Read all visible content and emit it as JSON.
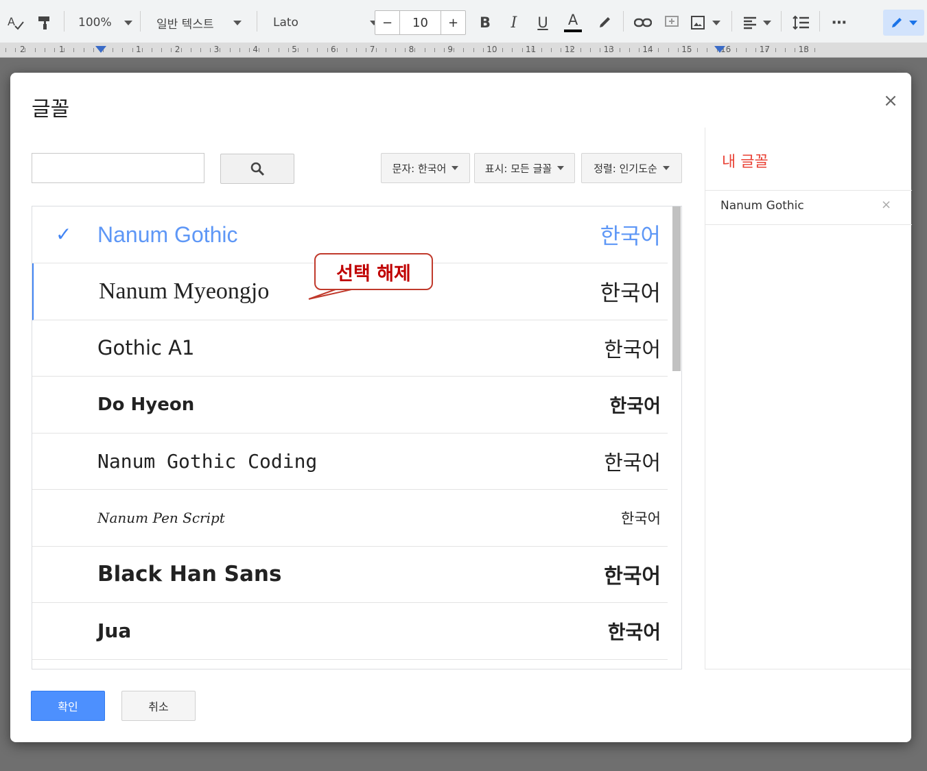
{
  "toolbar": {
    "zoom": "100%",
    "style": "일반 텍스트",
    "font": "Lato",
    "font_size": "10",
    "minus": "−",
    "plus": "+",
    "bold": "B",
    "italic": "I",
    "underline": "U",
    "text_color": "A",
    "more": "⋯"
  },
  "ruler": {
    "numbers": [
      "2",
      "1",
      "1",
      "2",
      "3",
      "4",
      "5",
      "6",
      "7",
      "8",
      "9",
      "10",
      "11",
      "12",
      "13",
      "14",
      "15",
      "16",
      "17",
      "18"
    ]
  },
  "dialog": {
    "title": "글꼴",
    "close": "×",
    "search_value": "",
    "filters": {
      "script": "문자: 한국어",
      "show": "표시: 모든 글꼴",
      "sort": "정렬: 인기도순"
    },
    "fonts": [
      {
        "name": "Nanum Gothic",
        "sample": "한국어",
        "selected": true
      },
      {
        "name": "Nanum Myeongjo",
        "sample": "한국어",
        "selected": false
      },
      {
        "name": "Gothic A1",
        "sample": "한국어",
        "selected": false
      },
      {
        "name": "Do Hyeon",
        "sample": "한국어",
        "selected": false
      },
      {
        "name": "Nanum Gothic Coding",
        "sample": "한국어",
        "selected": false
      },
      {
        "name": "Nanum Pen Script",
        "sample": "한국어",
        "selected": false
      },
      {
        "name": "Black Han Sans",
        "sample": "한국어",
        "selected": false
      },
      {
        "name": "Jua",
        "sample": "한국어",
        "selected": false
      }
    ],
    "check_mark": "✓",
    "my_fonts": {
      "title": "내 글꼴",
      "items": [
        {
          "name": "Nanum Gothic",
          "remove": "×"
        }
      ]
    },
    "ok_label": "확인",
    "cancel_label": "취소"
  },
  "callout": {
    "text": "선택 해제",
    "color": "#c00000"
  },
  "colors": {
    "accent": "#4285f4",
    "selected_text": "#5e97f6",
    "my_fonts_title": "#e94235",
    "ok_button": "#4d90fe"
  }
}
